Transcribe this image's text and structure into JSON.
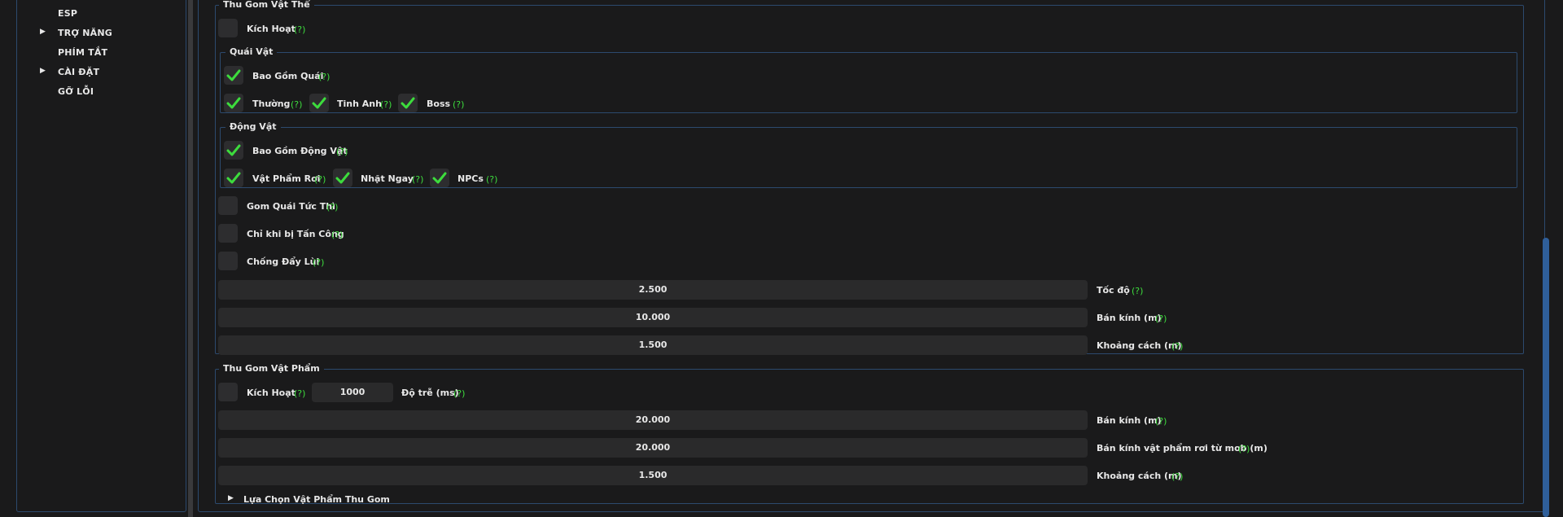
{
  "sidebar": {
    "items": [
      {
        "label": "ESP",
        "arrow": ""
      },
      {
        "label": "TRỢ NĂNG",
        "arrow": "▶"
      },
      {
        "label": "PHÍM TẮT",
        "arrow": ""
      },
      {
        "label": "CÀI ĐẶT",
        "arrow": "▶"
      },
      {
        "label": "GỠ LỖI",
        "arrow": ""
      }
    ]
  },
  "help_text": "(?)",
  "colors": {
    "accent": "#3ddc3d",
    "border": "#2c4a6e",
    "scrollbar": "#2f5f9a",
    "background": "#1a1a1b"
  },
  "entity_collect": {
    "title": "Thu Gom Vật Thể",
    "enable_label": "Kích Hoạt",
    "enable_checked": false,
    "monsters": {
      "title": "Quái Vật",
      "include_label": "Bao Gồm Quái",
      "include_checked": true,
      "normal_label": "Thường",
      "normal_checked": true,
      "elite_label": "Tinh Anh",
      "elite_checked": true,
      "boss_label": "Boss",
      "boss_checked": true
    },
    "animals": {
      "title": "Động Vật",
      "include_label": "Bao Gồm Động Vật",
      "include_checked": true,
      "drops_label": "Vật Phẩm Rơi",
      "drops_checked": true,
      "pickup_label": "Nhặt Ngay",
      "pickup_checked": true,
      "npcs_label": "NPCs",
      "npcs_checked": true
    },
    "instant_label": "Gom Quái Tức Thì",
    "instant_checked": false,
    "attacked_label": "Chỉ khi bị Tấn Công",
    "attacked_checked": false,
    "knockback_label": "Chống Đẩy Lùi",
    "knockback_checked": false,
    "speed_value": "2.500",
    "speed_label": "Tốc độ",
    "radius_value": "10.000",
    "radius_label": "Bán kính (m)",
    "distance_value": "1.500",
    "distance_label": "Khoảng cách (m)"
  },
  "item_collect": {
    "title": "Thu Gom Vật Phẩm",
    "enable_label": "Kích Hoạt",
    "enable_checked": false,
    "delay_value": "1000",
    "delay_label": "Độ trễ (ms)",
    "radius_value": "20.000",
    "radius_label": "Bán kính (m)",
    "mob_drop_radius_value": "20.000",
    "mob_drop_radius_label": "Bán kính vật phẩm rơi từ mob (m)",
    "distance_value": "1.500",
    "distance_label": "Khoảng cách (m)",
    "select_items_label": "Lựa Chọn Vật Phẩm Thu Gom",
    "select_items_arrow": "▶"
  }
}
